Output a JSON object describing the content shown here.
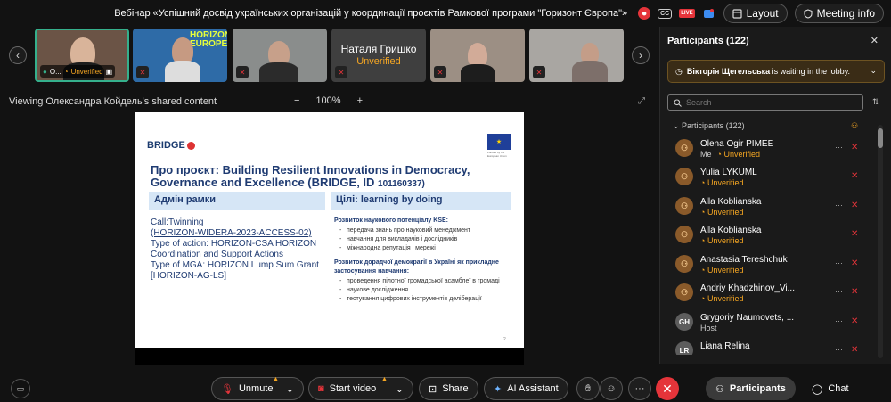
{
  "header": {
    "title": "Вебінар «Успішний досвід українських організацій у координації проєктів Рамкової програми \"Горизонт Європа\"»",
    "layout_label": "Layout",
    "meeting_info_label": "Meeting info",
    "rec_glyph": "⏺",
    "cc_label": "CC",
    "live_label": "LIVE"
  },
  "video_strip": {
    "tiles": [
      {
        "label": "O...",
        "status": "Unverified"
      },
      {
        "label": "",
        "status": ""
      },
      {
        "label": "",
        "status": ""
      },
      {
        "label": "Наталя Гришко",
        "status": "Unverified"
      },
      {
        "label": "",
        "status": ""
      },
      {
        "label": "",
        "status": ""
      }
    ],
    "tile2_text": "HORIZON EUROPE"
  },
  "share_bar": {
    "viewing_text": "Viewing Олександра Койдель's shared content",
    "zoom_out": "−",
    "zoom_level": "100%",
    "zoom_in": "+"
  },
  "slide": {
    "logo_text": "BRIDGE",
    "eu_flag_caption": "Funded by the European Union",
    "title": "Про проєкт: Building Resilient Innovations in Democracy, Governance and Excellence (BRIDGE, ID",
    "title_id": "101160337)",
    "left_header": "Адмін рамки",
    "right_header": "Цілі: learning by doing",
    "left_lines": [
      "Call:",
      "Twinning",
      "(HORIZON-WIDERA-2023-ACCESS-02)",
      "Type of action: HORIZON-CSA HORIZON Coordination and Support Actions",
      "Type of MGA: HORIZON Lump Sum Grant [HORIZON-AG-LS]"
    ],
    "right_section1_title": "Розвиток наукового потенціалу KSE:",
    "right_section1_items": [
      "передача знань про науковий менеджмент",
      "навчання для викладачів і дослідників",
      "міжнародна репутація і мережі"
    ],
    "right_section2_title": "Розвиток дорадчої демократії в Україні як прикладне застосування навчання:",
    "right_section2_items": [
      "проведення пілотної громадської асамблеї в громаді",
      "наукове дослідження",
      "тестування цифрових інструментів деліберації"
    ],
    "page_number": "2"
  },
  "panel": {
    "title": "Participants (122)",
    "lobby_name": "Вікторія Щегельська",
    "lobby_text": " is waiting in the lobby.",
    "search_placeholder": "Search",
    "list_label": "Participants (122)",
    "participants": [
      {
        "initials": "",
        "name": "Olena Ogir PIMEE",
        "me": "Me",
        "status": "Unverified"
      },
      {
        "initials": "",
        "name": "Yulia LYKUML",
        "me": "",
        "status": "Unverified"
      },
      {
        "initials": "",
        "name": "Alla Koblianska",
        "me": "",
        "status": "Unverified"
      },
      {
        "initials": "",
        "name": "Alla Koblianska",
        "me": "",
        "status": "Unverified"
      },
      {
        "initials": "",
        "name": "Anastasia Tereshchuk",
        "me": "",
        "status": "Unverified"
      },
      {
        "initials": "",
        "name": "Andriy Khadzhinov_Vi...",
        "me": "",
        "status": "Unverified"
      },
      {
        "initials": "GH",
        "name": "Grygoriy Naumovets, ...",
        "me": "",
        "status": "Host"
      },
      {
        "initials": "LR",
        "name": "Liana Relina",
        "me": "",
        "status": ""
      }
    ]
  },
  "toolbar": {
    "unmute_label": "Unmute",
    "start_video_label": "Start video",
    "share_label": "Share",
    "ai_label": "AI Assistant",
    "participants_label": "Participants",
    "chat_label": "Chat",
    "end_glyph": "✕"
  },
  "colors": {
    "accent_unverified": "#f5a623",
    "mute_red": "#e5343a",
    "active_tile_border": "#35b08c"
  }
}
